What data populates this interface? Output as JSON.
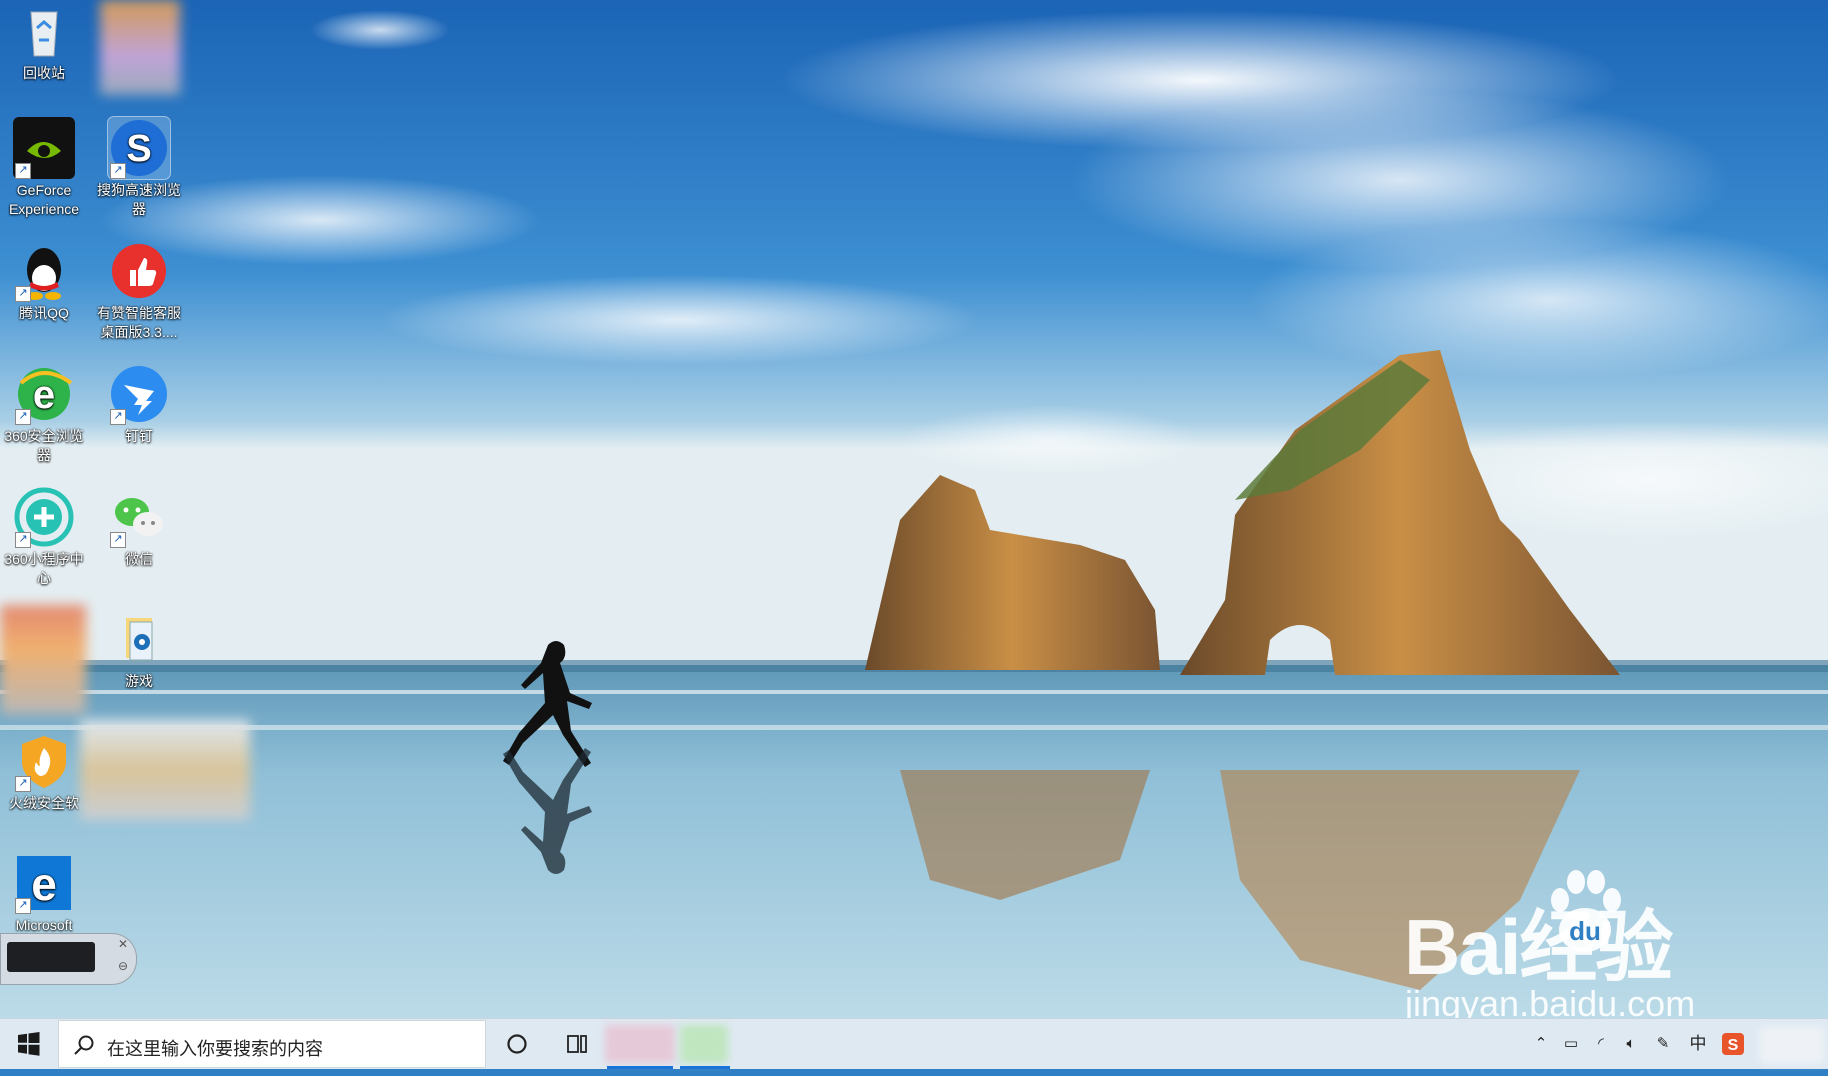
{
  "desktop": {
    "icons": [
      {
        "label": "回收站",
        "icon": "recycle-bin-icon"
      },
      {
        "label": "GeForce Experience",
        "icon": "geforce-icon"
      },
      {
        "label": "搜狗高速浏览器",
        "icon": "sogou-browser-icon"
      },
      {
        "label": "腾讯QQ",
        "icon": "qq-icon"
      },
      {
        "label": "有赞智能客服桌面版3.3....",
        "icon": "youzan-icon"
      },
      {
        "label": "360安全浏览器",
        "icon": "360-browser-icon"
      },
      {
        "label": "钉钉",
        "icon": "dingtalk-icon"
      },
      {
        "label": "360小程序中心",
        "icon": "360-miniapp-icon"
      },
      {
        "label": "微信",
        "icon": "wechat-icon"
      },
      {
        "label": "游戏",
        "icon": "game-folder-icon"
      },
      {
        "label": "火绒安全软",
        "icon": "huorong-icon"
      },
      {
        "label": "Microsoft",
        "icon": "edge-icon"
      }
    ]
  },
  "taskbar": {
    "search_placeholder": "在这里输入你要搜索的内容",
    "ime_label": "中",
    "colors": {
      "bar": "#dfe9f2",
      "accent": "#1a73d9"
    }
  },
  "watermark": {
    "logo": "Bai经验",
    "logo_du": "du",
    "url": "jingyan.baidu.com"
  }
}
